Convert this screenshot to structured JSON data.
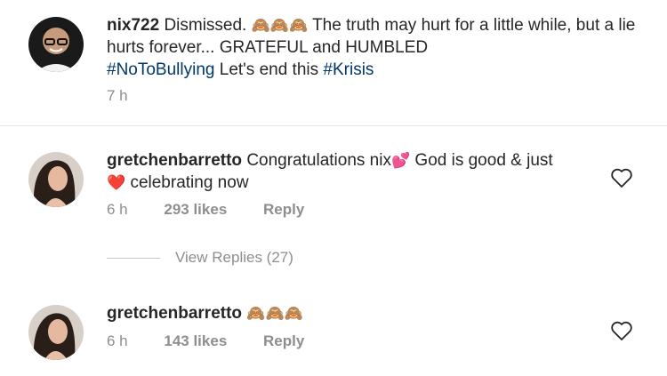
{
  "caption": {
    "username": "nix722",
    "text_1": "Dismissed.",
    "emoji_1": "🙈🙈🙈",
    "text_2": "The truth may hurt for a little while, but a lie hurts forever... GRATEFUL and HUMBLED",
    "hashtag_1": "#NoToBullying",
    "text_3": "Let's end this",
    "hashtag_2": "#Krisis",
    "time": "7 h"
  },
  "comments": [
    {
      "username": "gretchenbarretto",
      "text_1": "Congratulations nix",
      "emoji_1": "💕",
      "text_2": "God is good & just",
      "emoji_2": "❤️",
      "text_3": "celebrating now",
      "time": "6 h",
      "likes": "293 likes",
      "reply": "Reply"
    },
    {
      "username": "gretchenbarretto",
      "emoji_1": "🙈🙈🙈",
      "time": "6 h",
      "likes": "143 likes",
      "reply": "Reply"
    }
  ],
  "view_replies": "View Replies (27)",
  "colors": {
    "text": "#262626",
    "hashtag": "#00376b",
    "meta": "#8e8e8e"
  }
}
